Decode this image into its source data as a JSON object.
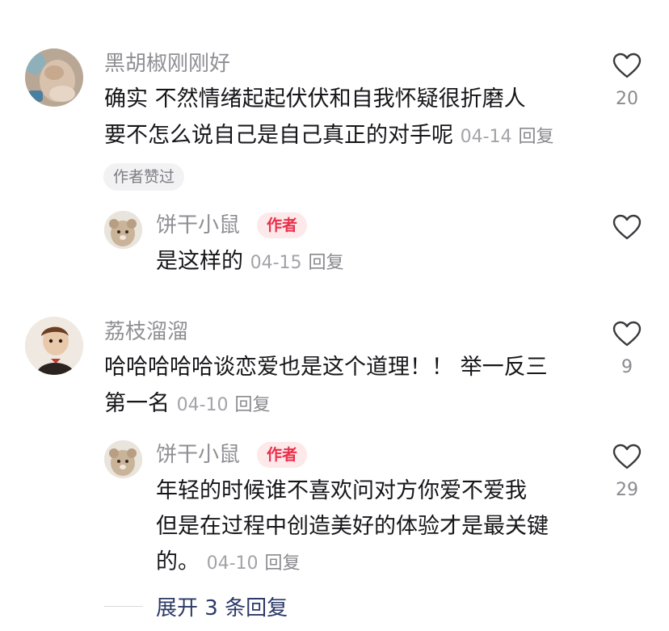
{
  "comments": [
    {
      "username": "黑胡椒刚刚好",
      "lines": [
        "确实 不然情绪起起伏伏和自我怀疑很折磨人",
        "要不怎么说自己是自己真正的对手呢"
      ],
      "date": "04-14",
      "reply_label": "回复",
      "liked_label": "作者赞过",
      "likes": "20",
      "avatar_icon": "cat-avatar-icon"
    },
    {
      "username": "饼干小鼠",
      "badge": "作者",
      "lines": [
        "是这样的"
      ],
      "date": "04-15",
      "reply_label": "回复",
      "likes": "",
      "avatar_icon": "mouse-avatar-icon"
    },
    {
      "username": "荔枝溜溜",
      "lines": [
        "哈哈哈哈哈谈恋爱也是这个道理！！ 举一反三",
        "第一名"
      ],
      "date": "04-10",
      "reply_label": "回复",
      "likes": "9",
      "avatar_icon": "child-avatar-icon"
    },
    {
      "username": "饼干小鼠",
      "badge": "作者",
      "lines": [
        "年轻的时候谁不喜欢问对方你爱不爱我",
        "但是在过程中创造美好的体验才是最关键",
        "的。"
      ],
      "date": "04-10",
      "reply_label": "回复",
      "likes": "29",
      "avatar_icon": "mouse-avatar-icon"
    }
  ],
  "expand_replies": "展开 3 条回复",
  "colors": {
    "username": "#8f8f94",
    "text": "#16161a",
    "badge_bg": "#fde8ea",
    "badge_text": "#e8304a",
    "expand_text": "#2b3a67"
  }
}
